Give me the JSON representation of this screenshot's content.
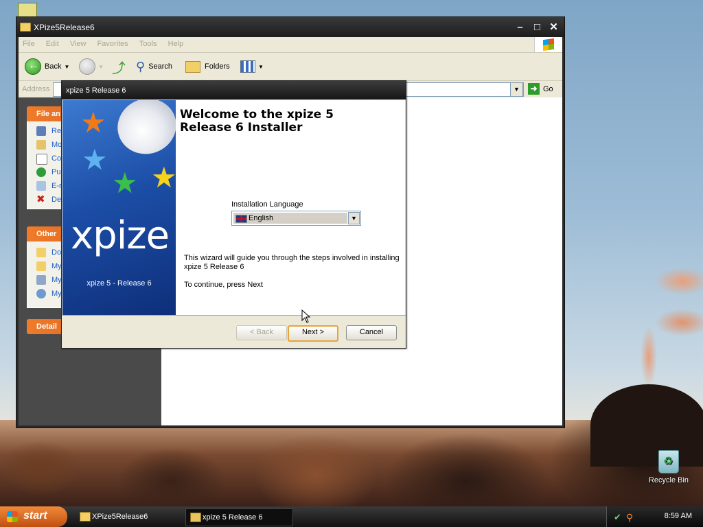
{
  "desktop": {
    "recycle_bin_label": "Recycle Bin"
  },
  "explorer": {
    "title": "XPize5Release6",
    "menu": [
      "File",
      "Edit",
      "View",
      "Favorites",
      "Tools",
      "Help"
    ],
    "toolbar": {
      "back_label": "Back",
      "search_label": "Search",
      "folders_label": "Folders"
    },
    "address_label": "Address",
    "go_label": "Go",
    "panels": {
      "file_tasks_label": "File an",
      "file_tasks_items": [
        "Re",
        "Mo",
        "Co",
        "Pu",
        "E-r",
        "De"
      ],
      "other_places_label": "Other",
      "other_places_items": [
        "Do",
        "My",
        "My",
        "My"
      ],
      "details_label": "Detail"
    }
  },
  "installer": {
    "title": "xpize 5 Release 6",
    "heading": "Welcome to the xpize 5 Release 6 Installer",
    "side_brand": "xpize",
    "side_caption": "xpize 5 - Release 6",
    "language_label": "Installation Language",
    "language_value": "English",
    "description": "This wizard will guide you through the steps involved in installing xpize 5 Release 6",
    "continue_text": "To continue, press Next",
    "buttons": {
      "back": "< Back",
      "next": "Next >",
      "cancel": "Cancel"
    }
  },
  "taskbar": {
    "start_label": "start",
    "tasks": [
      "XPize5Release6",
      "xpize 5 Release 6"
    ],
    "clock": "8:59 AM"
  },
  "colors": {
    "accent_orange": "#e46a20",
    "installer_blue": "#1c4ea7",
    "default_button_border": "#e7a33a"
  }
}
